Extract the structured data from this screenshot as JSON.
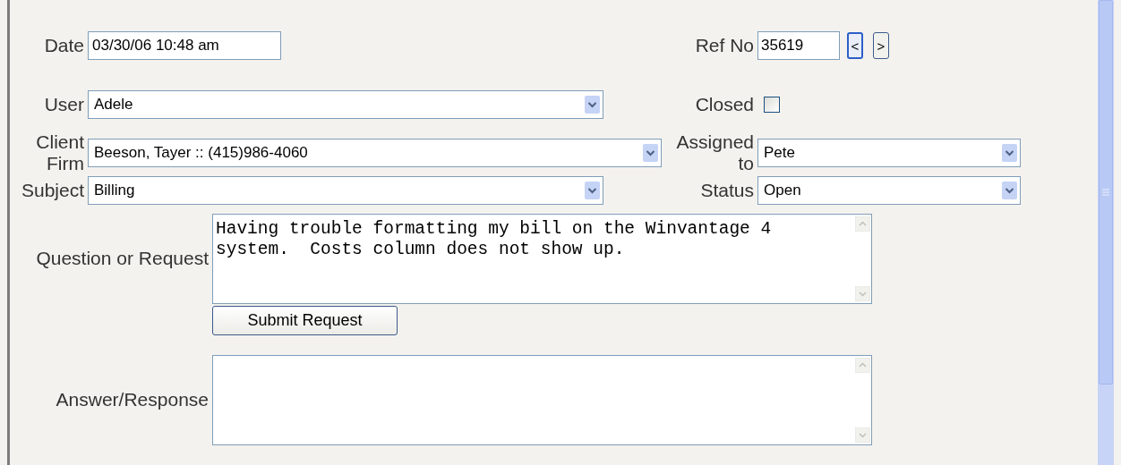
{
  "date": {
    "label": "Date",
    "value": "03/30/06 10:48 am"
  },
  "ref_no": {
    "label": "Ref No",
    "value": "35619",
    "prev_button": "<",
    "next_button": ">"
  },
  "user": {
    "label": "User",
    "value": "Adele"
  },
  "closed": {
    "label": "Closed",
    "checked": false
  },
  "client_firm": {
    "label": "Client Firm",
    "value": "Beeson, Tayer :: (415)986-4060"
  },
  "assigned_to": {
    "label": "Assigned to",
    "value": "Pete"
  },
  "subject": {
    "label": "Subject",
    "value": "Billing"
  },
  "status": {
    "label": "Status",
    "value": "Open"
  },
  "question": {
    "label": "Question or Request",
    "value": "Having trouble formatting my bill on the Winvantage 4\nsystem.  Costs column does not show up."
  },
  "submit_button": "Submit Request",
  "answer": {
    "label": "Answer/Response"
  }
}
